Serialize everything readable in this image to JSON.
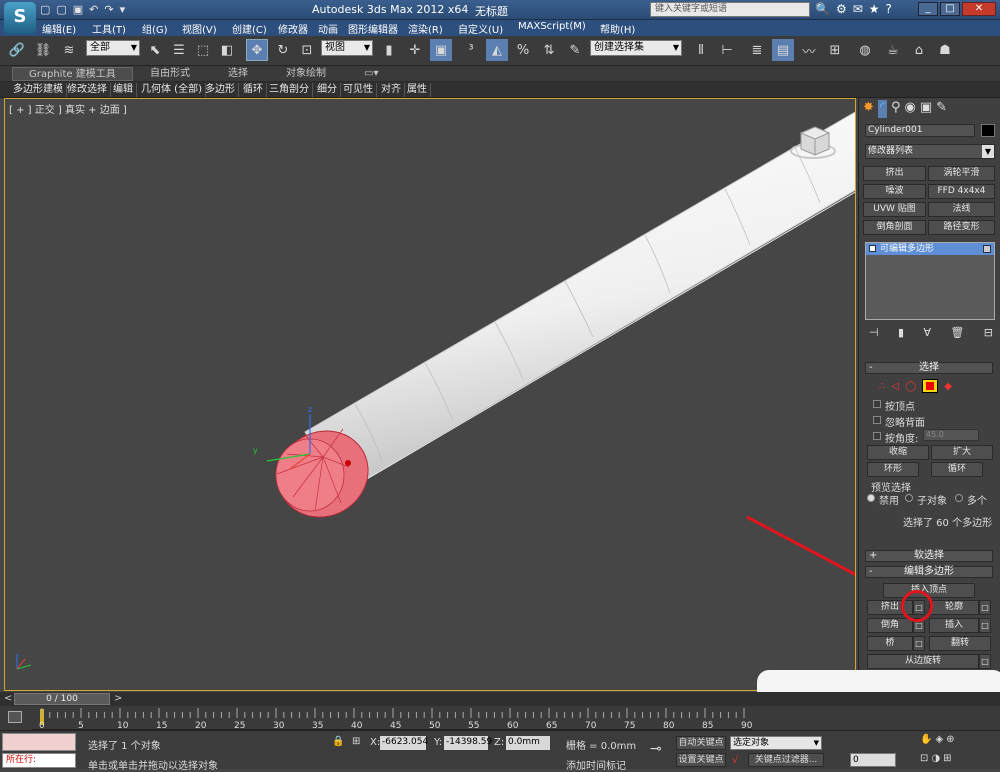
{
  "window": {
    "title_app": "Autodesk 3ds Max  2012 x64",
    "title_file": "无标题",
    "search_placeholder": "键入关键字或短语"
  },
  "menu": [
    "编辑(E)",
    "工具(T)",
    "组(G)",
    "视图(V)",
    "创建(C)",
    "修改器",
    "动画",
    "图形编辑器",
    "渲染(R)",
    "自定义(U)",
    "MAXScript(M)",
    "帮助(H)"
  ],
  "toolbar": {
    "selection_filter": "全部",
    "reference_coord": "视图",
    "named_selection": "创建选择集"
  },
  "ribbon": {
    "tabs": [
      "Graphite 建模工具",
      "自由形式",
      "选择",
      "对象绘制"
    ],
    "sub_items": [
      "多边形建模",
      "修改选择",
      "编辑",
      "几何体 (全部)",
      "多边形",
      "循环",
      "三角剖分",
      "细分",
      "可见性",
      "对齐",
      "属性"
    ]
  },
  "viewport": {
    "label": "[ + ] 正交 ] 真实 + 边面 ]"
  },
  "command_panel": {
    "object_name": "Cylinder001",
    "modifier_list": "修改器列表",
    "modifier_buttons": [
      "挤出",
      "涡轮平滑",
      "噪波",
      "FFD 4x4x4",
      "UVW 贴图",
      "法线",
      "倒角剖面",
      "路径变形"
    ],
    "stack_item": "可编辑多边形",
    "selection_rollout": "选择",
    "by_vertex": "按顶点",
    "ignore_backfacing": "忽略背面",
    "by_angle": "按角度:",
    "angle_value": "45.0",
    "shrink": "收缩",
    "grow": "扩大",
    "ring": "环形",
    "loop": "循环",
    "preview_selection": "预览选择",
    "preview_disabled": "禁用",
    "preview_subobject": "子对象",
    "preview_multi": "多个",
    "selected_count": "选择了 60 个多边形",
    "soft_selection": "软选择",
    "edit_polygons": "编辑多边形",
    "insert_vertex": "插入顶点",
    "extrude": "挤出",
    "outline": "轮廓",
    "bevel": "倒角",
    "inset": "插入",
    "bridge": "桥",
    "flip": "翻转",
    "hinge_from_edge": "从边旋转"
  },
  "timeline": {
    "frame": "0 / 100",
    "ticks": [
      "0",
      "5",
      "10",
      "15",
      "20",
      "25",
      "30",
      "35",
      "40",
      "45",
      "50",
      "55",
      "60",
      "65",
      "70",
      "75",
      "80",
      "85",
      "90"
    ]
  },
  "status": {
    "current": "所在行:",
    "selected": "选择了 1 个对象",
    "prompt": "单击或单击并拖动以选择对象",
    "x": "-6623.054",
    "y": "-14398.59",
    "z": "0.0mm",
    "grid": "栅格 = 0.0mm",
    "auto_key": "自动关键点",
    "set_key": "设置关键点",
    "selected_objects": "选定对象",
    "key_filters": "关键点过滤器...",
    "add_time_tag": "添加时间标记",
    "frame_value": "0"
  }
}
